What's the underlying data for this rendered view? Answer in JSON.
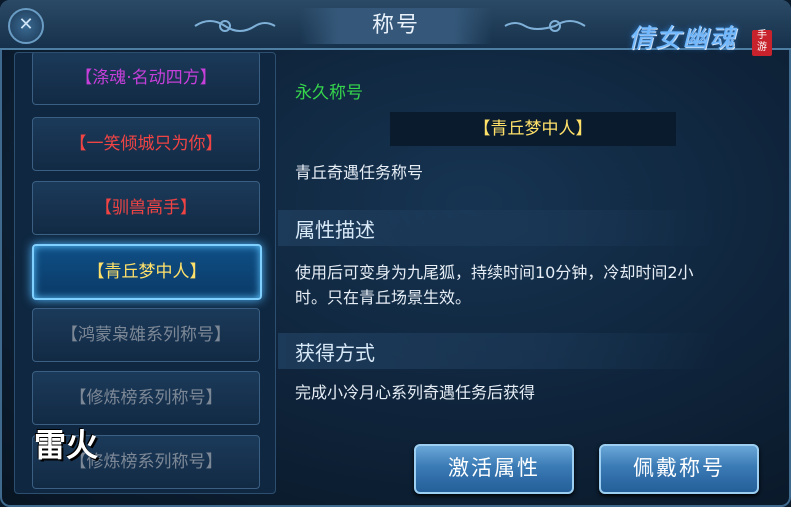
{
  "window": {
    "title": "称号",
    "logo": "倩女幽魂 手游"
  },
  "title_list": [
    {
      "label": "【涤魂·名动四方】",
      "color": "#c53fd9",
      "state": "normal"
    },
    {
      "label": "【一笑倾城只为你】",
      "color": "#f04444",
      "state": "normal"
    },
    {
      "label": "【驯兽高手】",
      "color": "#f04444",
      "state": "normal"
    },
    {
      "label": "【青丘梦中人】",
      "color": "#ffe16a",
      "state": "selected"
    },
    {
      "label": "【鸿蒙枭雄系列称号】",
      "color": "#7d8896",
      "state": "locked"
    },
    {
      "label": "【修炼榜系列称号】",
      "color": "#7d8896",
      "state": "locked"
    },
    {
      "label": "【修炼榜系列称号】",
      "color": "#7d8896",
      "state": "locked"
    }
  ],
  "detail": {
    "duration_label": "永久称号",
    "title_name": "【青丘梦中人】",
    "source_desc": "青丘奇遇任务称号",
    "attr_heading": "属性描述",
    "attr_text_line1": "使用后可变身为九尾狐，持续时间10分钟，冷却时间2小",
    "attr_text_line2": "时。只在青丘场景生效。",
    "obtain_heading": "获得方式",
    "obtain_text": "完成小冷月心系列奇遇任务后获得"
  },
  "buttons": {
    "activate": "激活属性",
    "wear": "佩戴称号"
  },
  "watermark": "雷火",
  "colors": {
    "accent": "#7fd0ff",
    "gold": "#ffe16a",
    "green": "#35d64c"
  }
}
